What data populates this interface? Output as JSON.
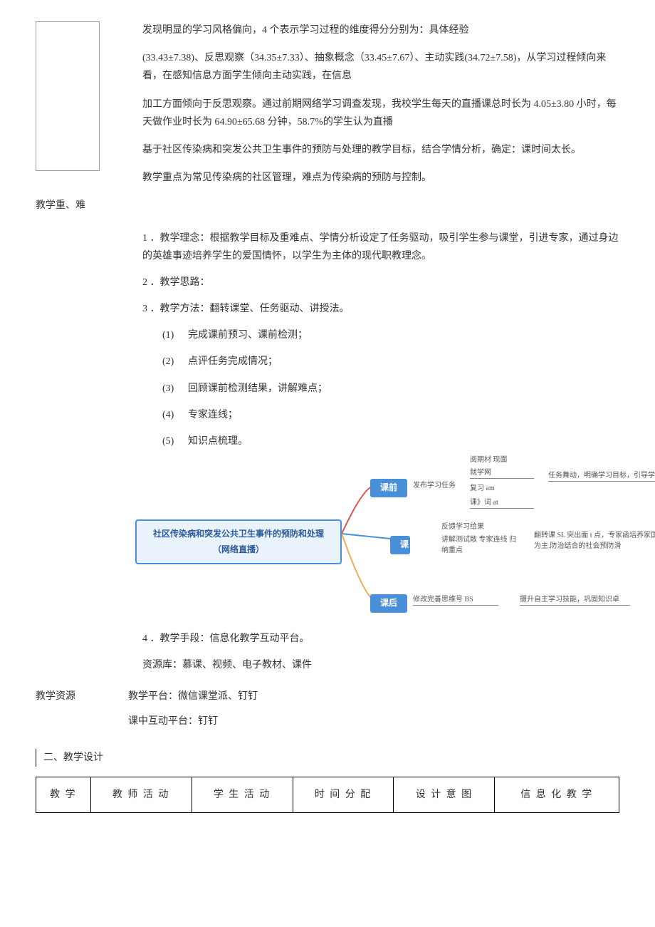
{
  "para1": "发现明显的学习风格偏向，4 个表示学习过程的维度得分分别为：具体经验",
  "para2": "(33.43±7.38)、反思观察（34.35±7.33）、抽象概念（33.45±7.67）、主动实践(34.72±7.58)，从学习过程倾向来看，在感知信息方面学生倾向主动实践，在信息",
  "para3": "加工方面倾向于反思观察。通过前期网络学习调查发现，我校学生每天的直播课总时长为 4.05±3.80 小时，每天做作业时长为 64.90±65.68 分钟，58.7%的学生认为直播",
  "para4": "基于社区传染病和突发公共卫生事件的预防与处理的教学目标，结合学情分析，确定：课时间太长。",
  "para5": "教学重点为常见传染病的社区管理，难点为传染病的预防与控制。",
  "side1": "教学重、难",
  "n1": "1 ．教学理念：根据教学目标及重难点、学情分析设定了任务驱动，吸引学生参与课堂，引进专家，通过身边的英雄事迹培养学生的爱国情怀，以学生为主体的现代职教理念。",
  "n2": "2 ．教学思路：",
  "n3": "3 ．教学方法：翻转课堂、任务驱动、讲授法。",
  "sub": {
    "s1": "完成课前预习、课前检测；",
    "s2": "点评任务完成情况；",
    "s3": "回顾课前检测结果，讲解难点；",
    "s4": "专家连线；",
    "s5": "知识点梳理。",
    "l1": "(1)",
    "l2": "(2)",
    "l3": "(3)",
    "l4": "(4)",
    "l5": "(5)"
  },
  "diagram": {
    "central_line1": "社区传染病和突发公共卫生事件的预防和处理",
    "central_line2": "（网络直播）",
    "node_pre": "课前",
    "node_mid": "课",
    "node_post": "课后",
    "pre_task": "发布学习任务",
    "pre_col1a": "阅期材 现面",
    "pre_col1b": "就学网",
    "pre_col1c": "复习 am",
    "pre_col1d": "课》词 at",
    "pre_right": "任务舞动，明确学习目标，引导学生自主学习",
    "mid_col1a": "反馈学习给果",
    "mid_col1b": "讲解测试敞 专家连线 归纳重点",
    "mid_right": "翻转课 SL 突出面 t 点，专家函培养家国瞬怀，的立 预防为主.防治结合的社会预防滑",
    "post_col1": "修改完善思维号 BS",
    "post_right": "摄升自主学习技能，巩固知识卓"
  },
  "n4": "4 ．教学手段：信息化教学互动平台。",
  "res1": "资源库：慕课、视频、电子教材、课件",
  "res_label": "教学资源",
  "res2": "教学平台：微信课堂派、钉钉",
  "res3": "课中互动平台：钉钉",
  "section2": "二、教学设计",
  "table": {
    "h1": "教 学",
    "h2": "教 师 活 动",
    "h3": "学 生 活 动",
    "h4": "时 间 分 配",
    "h5": "设 计 意 图",
    "h6": "信 息 化 教 学"
  }
}
